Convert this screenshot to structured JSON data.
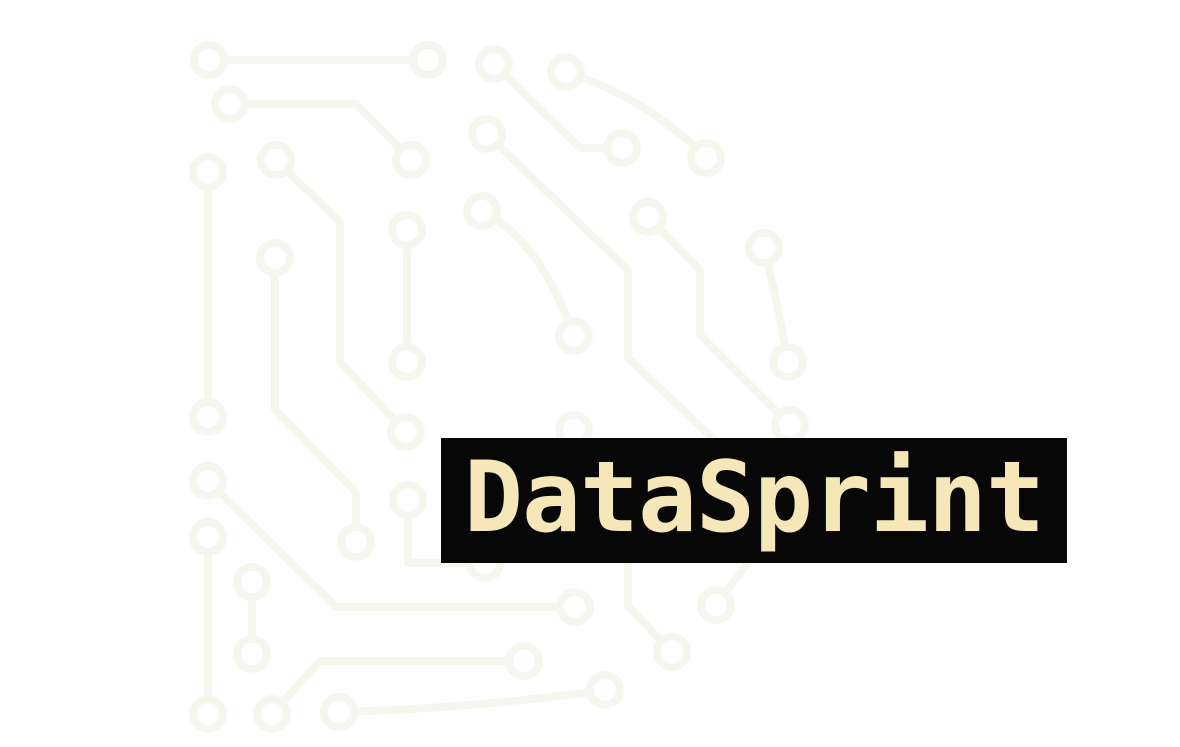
{
  "brand": {
    "name": "DataSprint",
    "text_color": "#f5e7b8",
    "box_color": "#070707",
    "circuit_color": "#f7f6ee",
    "background_color": "#ffffff",
    "graphic": "circuit-board-traces"
  }
}
